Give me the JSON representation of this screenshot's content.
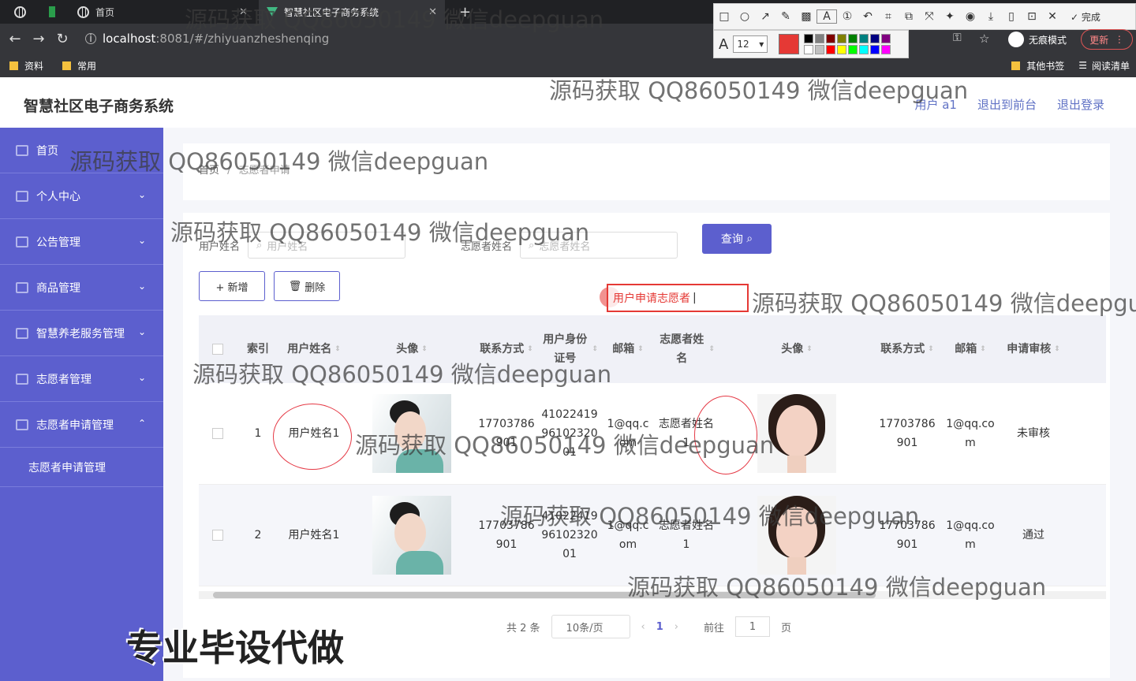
{
  "browser": {
    "tabs": [
      {
        "label": "首页"
      },
      {
        "label": "智慧社区电子商务系统"
      }
    ],
    "url_host": "localhost",
    "url_rest": ":8081/#/zhiyuanzheshenqing",
    "bookmarks": [
      "资料",
      "常用"
    ],
    "bookmarks_right": [
      "其他书签",
      "阅读清单"
    ],
    "incognito_label": "无痕模式",
    "update_label": "更新"
  },
  "draw_toolbar": {
    "done_label": "完成",
    "font_size": "12",
    "active_color": "#e53935",
    "palette": [
      "#000000",
      "#808080",
      "#800000",
      "#808000",
      "#008000",
      "#008080",
      "#000080",
      "#800080",
      "#ffffff",
      "#c0c0c0",
      "#ff0000",
      "#ffff00",
      "#00ff00",
      "#00ffff",
      "#0000ff",
      "#ff00ff"
    ]
  },
  "header": {
    "title": "智慧社区电子商务系统",
    "user": "用户 a1",
    "front_link": "退出到前台",
    "logout_link": "退出登录"
  },
  "sidebar": {
    "items": [
      {
        "label": "首页"
      },
      {
        "label": "个人中心"
      },
      {
        "label": "公告管理"
      },
      {
        "label": "商品管理"
      },
      {
        "label": "智慧养老服务管理"
      },
      {
        "label": "志愿者管理"
      },
      {
        "label": "志愿者申请管理"
      }
    ],
    "sub_item": "志愿者申请管理"
  },
  "breadcrumb": [
    "首页",
    "志愿者申请"
  ],
  "search": {
    "user_label": "用户姓名",
    "user_placeholder": "用户姓名",
    "vol_label": "志愿者姓名",
    "vol_placeholder": "志愿者姓名",
    "query_label": "查询"
  },
  "actions": {
    "add": "+ 新增",
    "delete": "删除"
  },
  "table": {
    "headers": [
      "索引",
      "用户姓名",
      "头像",
      "联系方式",
      "用户身份证号",
      "邮箱",
      "志愿者姓名",
      "头像",
      "联系方式",
      "邮箱",
      "申请审核"
    ],
    "rows": [
      {
        "index": "1",
        "user": "用户姓名1",
        "phone": "17703786901",
        "idcard": "410224199610232001",
        "email": "1@qq.com",
        "vol": "志愿者姓名1",
        "vphone": "17703786901",
        "vemail": "1@qq.com",
        "status": "未审核"
      },
      {
        "index": "2",
        "user": "用户姓名1",
        "phone": "17703786901",
        "idcard": "410224199610232001",
        "email": "1@qq.com",
        "vol": "志愿者姓名1",
        "vphone": "17703786901",
        "vemail": "1@qq.com",
        "status": "通过"
      }
    ]
  },
  "pager": {
    "total": "共 2 条",
    "size": "10条/页",
    "current": "1",
    "goto": "前往",
    "page_input": "1",
    "page_unit": "页"
  },
  "annotation": {
    "text": "用户申请志愿者"
  },
  "watermark": "源码获取 QQ86050149 微信deepguan",
  "promo": "专业毕设代做"
}
